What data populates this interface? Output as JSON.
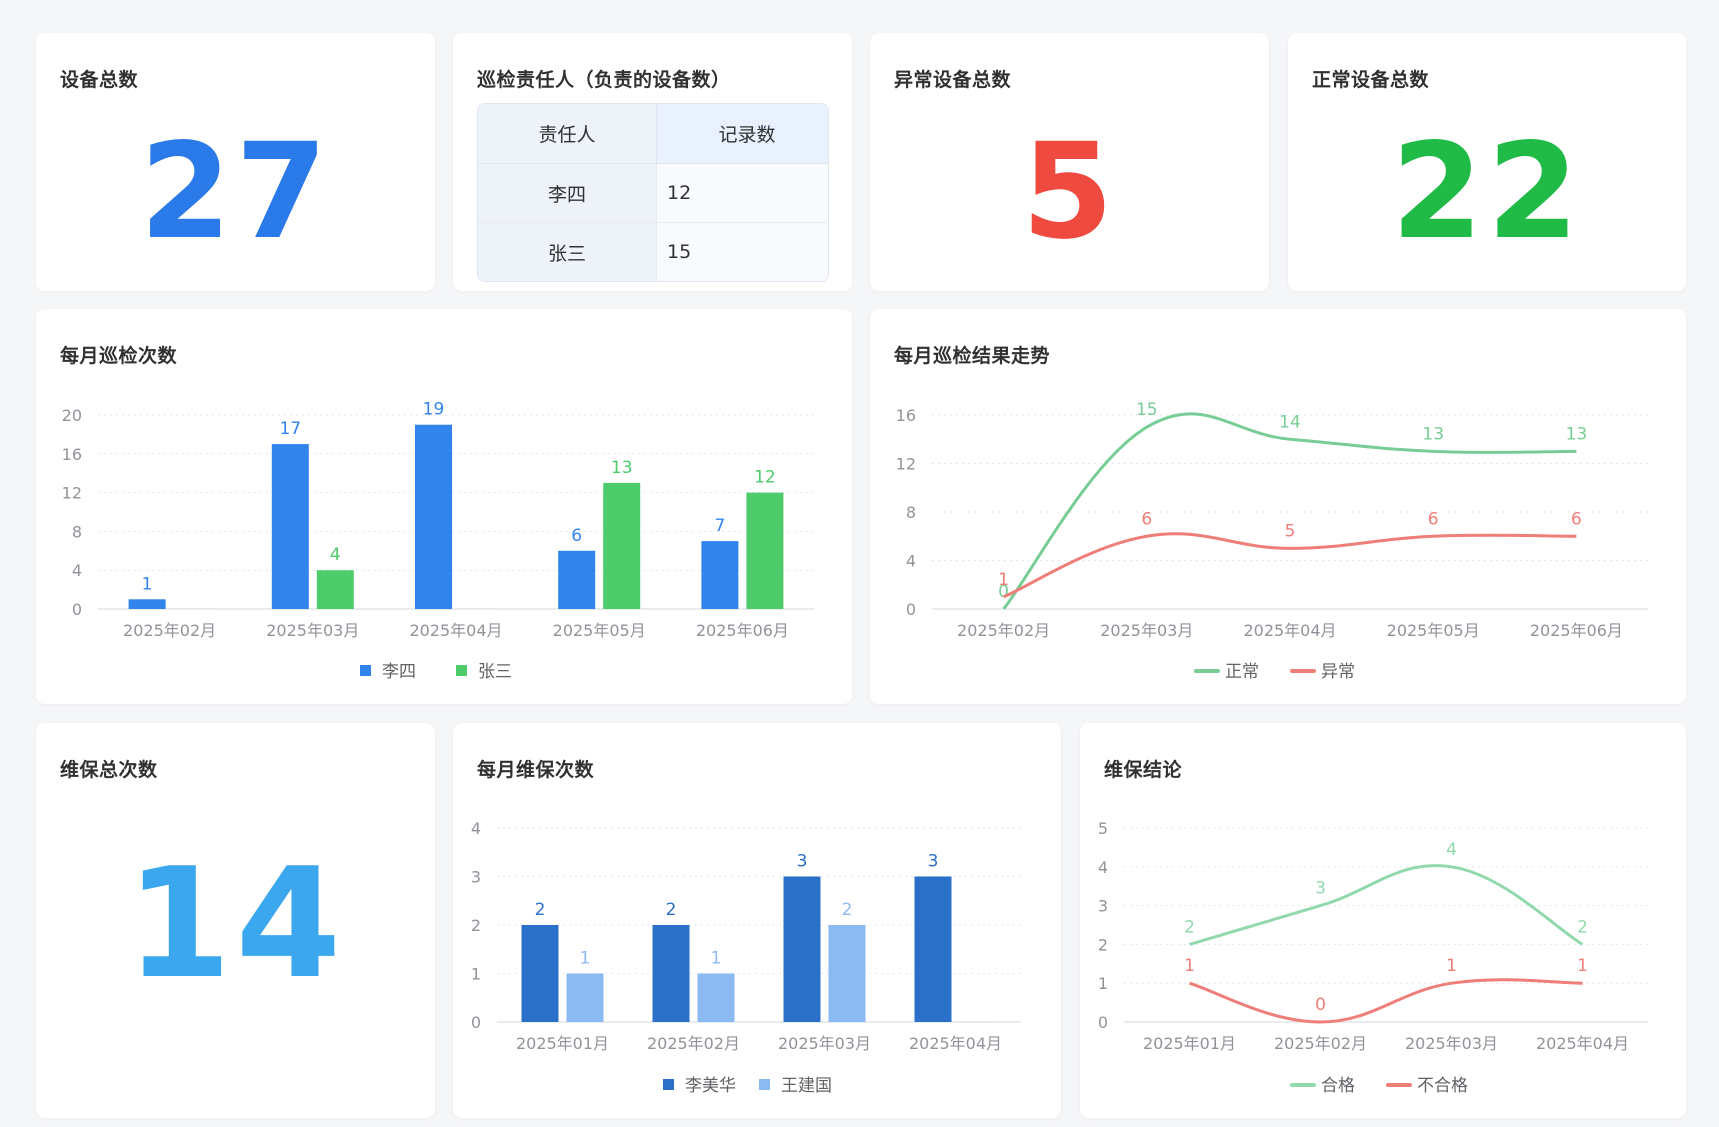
{
  "cards": {
    "device_total": {
      "title": "设备总数",
      "value": "27",
      "color": "#2a7ae9"
    },
    "inspector_table": {
      "title": "巡检责任人（负责的设备数）",
      "headers": [
        "责任人",
        "记录数"
      ],
      "rows": [
        [
          "李四",
          "12"
        ],
        [
          "张三",
          "15"
        ]
      ]
    },
    "abnormal_total": {
      "title": "异常设备总数",
      "value": "5",
      "color": "#ef4a40"
    },
    "normal_total": {
      "title": "正常设备总数",
      "value": "22",
      "color": "#1fbb46"
    },
    "monthly_inspections": {
      "title": "每月巡检次数"
    },
    "inspection_trend": {
      "title": "每月巡检结果走势"
    },
    "maintenance_total": {
      "title": "维保总次数",
      "value": "14",
      "color": "#3aa7ef"
    },
    "monthly_maintenance": {
      "title": "每月维保次数"
    },
    "maintenance_result": {
      "title": "维保结论"
    }
  },
  "chart_data": [
    {
      "id": "monthly_inspections",
      "type": "bar",
      "categories": [
        "2025年02月",
        "2025年03月",
        "2025年04月",
        "2025年05月",
        "2025年06月"
      ],
      "series": [
        {
          "name": "李四",
          "values": [
            1,
            17,
            19,
            6,
            7
          ],
          "color": "#3184ec"
        },
        {
          "name": "张三",
          "values": [
            0,
            4,
            0,
            13,
            12
          ],
          "color": "#4ecb6a"
        }
      ],
      "yticks": [
        0,
        4,
        8,
        12,
        16,
        20
      ],
      "ylim": [
        0,
        20
      ],
      "legend": "bottom"
    },
    {
      "id": "inspection_trend",
      "type": "line",
      "categories": [
        "2025年02月",
        "2025年03月",
        "2025年04月",
        "2025年05月",
        "2025年06月"
      ],
      "series": [
        {
          "name": "正常",
          "values": [
            0,
            15,
            14,
            13,
            13
          ],
          "color": "#77cd95"
        },
        {
          "name": "异常",
          "values": [
            1,
            6,
            5,
            6,
            6
          ],
          "color": "#ef7d78"
        }
      ],
      "yticks": [
        0,
        4,
        8,
        12,
        16
      ],
      "ylim": [
        0,
        16
      ],
      "legend": "bottom"
    },
    {
      "id": "monthly_maintenance",
      "type": "bar",
      "categories": [
        "2025年01月",
        "2025年02月",
        "2025年03月",
        "2025年04月"
      ],
      "series": [
        {
          "name": "李美华",
          "values": [
            2,
            2,
            3,
            3
          ],
          "color": "#2a6fc8"
        },
        {
          "name": "王建国",
          "values": [
            1,
            1,
            2,
            0
          ],
          "color": "#8bbaf3"
        }
      ],
      "yticks": [
        0,
        1,
        2,
        3,
        4
      ],
      "ylim": [
        0,
        4
      ],
      "legend": "bottom"
    },
    {
      "id": "maintenance_result",
      "type": "line",
      "categories": [
        "2025年01月",
        "2025年02月",
        "2025年03月",
        "2025年04月"
      ],
      "series": [
        {
          "name": "合格",
          "values": [
            2,
            3,
            4,
            2
          ],
          "color": "#91d9ac"
        },
        {
          "name": "不合格",
          "values": [
            1,
            0,
            1,
            1
          ],
          "color": "#ef7d78"
        }
      ],
      "yticks": [
        0,
        1,
        2,
        3,
        4,
        5
      ],
      "ylim": [
        0,
        5
      ],
      "legend": "bottom"
    }
  ]
}
